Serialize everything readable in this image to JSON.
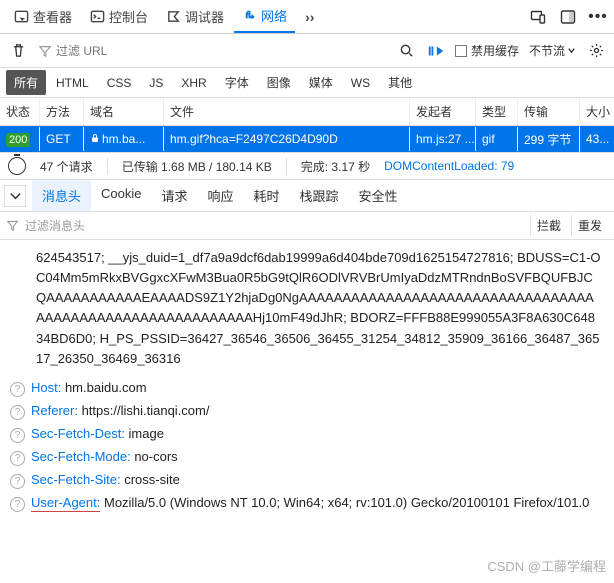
{
  "top_tabs": {
    "inspector": "查看器",
    "console": "控制台",
    "debugger": "调试器",
    "network": "网络",
    "more": "››"
  },
  "filter_bar": {
    "placeholder": "过滤 URL",
    "disable_cache": "禁用缓存",
    "throttle": "不节流"
  },
  "type_filters": [
    "所有",
    "HTML",
    "CSS",
    "JS",
    "XHR",
    "字体",
    "图像",
    "媒体",
    "WS",
    "其他"
  ],
  "table": {
    "headers": {
      "status": "状态",
      "method": "方法",
      "domain": "域名",
      "file": "文件",
      "initiator": "发起者",
      "type": "类型",
      "transferred": "传输",
      "size": "大小"
    },
    "rows": [
      {
        "status": "200",
        "method": "GET",
        "domain": "hm.ba...",
        "file": "hm.gif?hca=F2497C26D4D90D",
        "initiator": "hm.js:27 ...",
        "type": "gif",
        "transferred": "299 字节",
        "size": "43..."
      }
    ]
  },
  "summary": {
    "requests": "47 个请求",
    "transferred": "已传输 1.68 MB / 180.14 KB",
    "finish": "完成: 3.17 秒",
    "dcl": "DOMContentLoaded: 79"
  },
  "detail_tabs": [
    "消息头",
    "Cookie",
    "请求",
    "响应",
    "耗时",
    "栈跟踪",
    "安全性"
  ],
  "filter_headers": {
    "placeholder": "过滤消息头",
    "intercept": "拦截",
    "resend": "重发"
  },
  "body_blob": "624543517; __yjs_duid=1_df7a9a9dcf6dab19999a6d404bde709d1625154727816; BDUSS=C1-OC04Mm5mRkxBVGgxcXFwM3Bua0R5bG9tQlR6ODlVRVBrUmIyaDdzMTRndnBoSVFBQUFBJCQAAAAAAAAAAAEAAAADS9Z1Y2hjaDg0NgAAAAAAAAAAAAAAAAAAAAAAAAAAAAAAAAAAAAAAAAAAAAAAAAAAAAAAAAAAAHj10mF49dJhR; BDORZ=FFFB88E999055A3F8A630C64834BD6D0; H_PS_PSSID=36427_36546_36506_36455_31254_34812_35909_36166_36487_36517_26350_36469_36316",
  "resp_headers": [
    {
      "name": "Host",
      "value": "hm.baidu.com",
      "ua": false
    },
    {
      "name": "Referer",
      "value": "https://lishi.tianqi.com/",
      "ua": false
    },
    {
      "name": "Sec-Fetch-Dest",
      "value": "image",
      "ua": false
    },
    {
      "name": "Sec-Fetch-Mode",
      "value": "no-cors",
      "ua": false
    },
    {
      "name": "Sec-Fetch-Site",
      "value": "cross-site",
      "ua": false
    },
    {
      "name": "User-Agent",
      "value": "Mozilla/5.0 (Windows NT 10.0; Win64; x64; rv:101.0) Gecko/20100101 Firefox/101.0",
      "ua": true
    }
  ],
  "watermark": "CSDN @工藤学编程"
}
